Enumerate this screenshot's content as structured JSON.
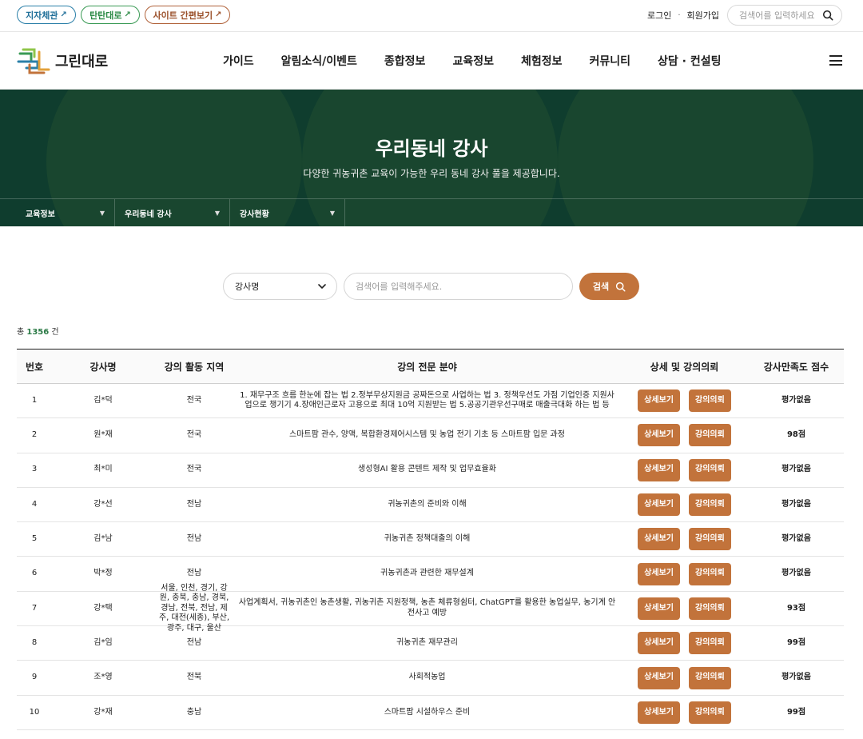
{
  "topbar": {
    "pills": [
      {
        "label": "지자체관",
        "arrow": "↗"
      },
      {
        "label": "탄탄대로",
        "arrow": "↗"
      },
      {
        "label": "사이트 간편보기",
        "arrow": "↗"
      }
    ],
    "login": "로그인",
    "separator": "·",
    "signup": "회원가입",
    "search_placeholder": "검색어를 입력하세요"
  },
  "header": {
    "logo_text": "그린대로",
    "gnb": [
      "가이드",
      "알림소식/이벤트",
      "종합정보",
      "교육정보",
      "체험정보",
      "커뮤니티",
      "상담 · 컨설팅"
    ]
  },
  "hero": {
    "title": "우리동네 강사",
    "subtitle": "다양한 귀농귀촌 교육이 가능한 우리 동네 강사 풀을 제공합니다.",
    "subnav": [
      "교육정보",
      "우리동네 강사",
      "강사현황"
    ]
  },
  "search": {
    "select_value": "강사명",
    "input_placeholder": "검색어를 입력해주세요.",
    "button_label": "검색"
  },
  "total": {
    "prefix": "총",
    "count": "1356",
    "suffix": "건"
  },
  "table": {
    "headers": [
      "번호",
      "강사명",
      "강의 활동 지역",
      "강의 전문 분야",
      "상세 및 강의의뢰",
      "강사만족도 점수"
    ],
    "detail_label": "상세보기",
    "request_label": "강의의뢰",
    "rows": [
      {
        "no": "1",
        "name": "김*덕",
        "area": "전국",
        "field": "1. 재무구조 흐름 한눈에 잡는 법 2.정부무상지원금 공짜돈으로 사업하는 법 3. 정책우선도 가점 기업인증 지원사업으로 챙기기 4.장애인근로자 고용으로 최대 10억 지원받는 법 5.공공기관우선구매로 매출극대화 하는 법 등",
        "score": "평가없음"
      },
      {
        "no": "2",
        "name": "원*재",
        "area": "전국",
        "field": "스마트팜 관수, 양액, 복합환경제어시스템 및 농업 전기 기초 등 스마트팜 입문 과정",
        "score": "98점"
      },
      {
        "no": "3",
        "name": "최*미",
        "area": "전국",
        "field": "생성형AI 활용 콘텐트 제작 및 업무효율화",
        "score": "평가없음"
      },
      {
        "no": "4",
        "name": "강*선",
        "area": "전남",
        "field": "귀농귀촌의 준비와 이해",
        "score": "평가없음"
      },
      {
        "no": "5",
        "name": "김*남",
        "area": "전남",
        "field": "귀농귀촌 정책대출의 이해",
        "score": "평가없음"
      },
      {
        "no": "6",
        "name": "박*정",
        "area": "전남",
        "field": "귀농귀촌과 관련한 재무설계",
        "score": "평가없음"
      },
      {
        "no": "7",
        "name": "강*택",
        "area": "서울, 인천, 경기, 강원, 충북, 충남, 경북, 경남, 전북, 전남, 제주, 대전(세종), 부산, 광주, 대구, 울산",
        "field": "사업계획서, 귀농귀촌인 농촌생활, 귀농귀촌 지원정책, 농촌 체류형쉼터, ChatGPT를 활용한 농업실무, 농기계 안전사고 예방",
        "score": "93점"
      },
      {
        "no": "8",
        "name": "김*임",
        "area": "전남",
        "field": "귀농귀촌 재무관리",
        "score": "99점"
      },
      {
        "no": "9",
        "name": "조*영",
        "area": "전북",
        "field": "사회적농업",
        "score": "평가없음"
      },
      {
        "no": "10",
        "name": "강*재",
        "area": "충남",
        "field": "스마트팜 시설하우스 준비",
        "score": "99점"
      }
    ]
  },
  "colors": {
    "hero_bg": "#0f3d2e",
    "accent_button": "#c2733b",
    "count_green": "#2b7a46"
  }
}
